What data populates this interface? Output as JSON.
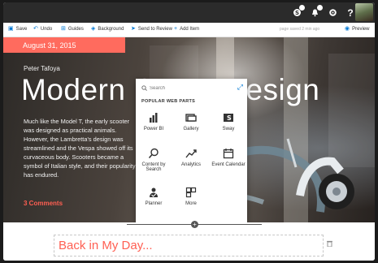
{
  "suite_bar": {
    "icons": [
      "skype-icon",
      "notifications-icon",
      "settings-icon",
      "help-icon"
    ],
    "help_label": "?"
  },
  "command_bar": {
    "save": "Save",
    "undo": "Undo",
    "guides": "Guides",
    "background": "Background",
    "send_to_review": "Send to Review",
    "add_item": "Add Item",
    "saved_status": "page saved 2 min ago",
    "preview": "Preview"
  },
  "article": {
    "date": "August 31, 2015",
    "author": "Peter Tafoya",
    "title": "Modern S",
    "title_tail": "esign",
    "body": "Much like the Model T, the early scooter was designed as practical animals. However, the Lambretta's design was streamlined and the Vespa showed off its curvaceous body. Scooters became a symbol of Italian style, and their popularity has endured.",
    "comments": "3 Comments",
    "accent_color": "#ff6b5e"
  },
  "web_parts_panel": {
    "search_placeholder": "Search",
    "heading": "POPULAR WEB PARTS",
    "items": [
      {
        "label": "Power BI",
        "icon": "power-bi-icon"
      },
      {
        "label": "Gallery",
        "icon": "gallery-icon"
      },
      {
        "label": "Sway",
        "icon": "sway-icon"
      },
      {
        "label": "Content by Search",
        "icon": "search-icon"
      },
      {
        "label": "Analytics",
        "icon": "analytics-icon"
      },
      {
        "label": "Event Calendar",
        "icon": "calendar-icon"
      },
      {
        "label": "Planner",
        "icon": "planner-icon"
      },
      {
        "label": "More",
        "icon": "more-icon"
      }
    ]
  },
  "section_heading": {
    "text": "Back in My Day..."
  }
}
